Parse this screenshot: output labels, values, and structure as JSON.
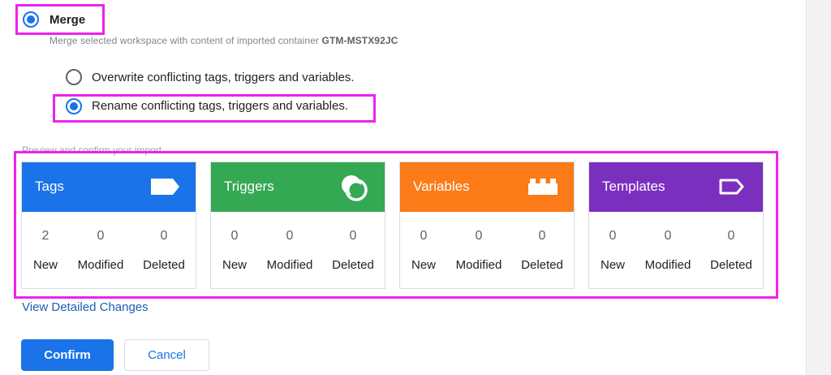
{
  "import_mode": {
    "merge_label": "Merge",
    "merge_description": "Merge selected workspace with content of imported container",
    "container_id": "GTM-MSTX92JC",
    "options": [
      {
        "label": "Overwrite conflicting tags, triggers and variables.",
        "selected": false
      },
      {
        "label": "Rename conflicting tags, triggers and variables.",
        "selected": true
      }
    ]
  },
  "preview": {
    "label": "Preview and confirm your import",
    "cards": [
      {
        "title": "Tags",
        "icon": "tag-icon",
        "color": "#1a73e8",
        "new": "2",
        "modified": "0",
        "deleted": "0"
      },
      {
        "title": "Triggers",
        "icon": "trigger-icon",
        "color": "#34a853",
        "new": "0",
        "modified": "0",
        "deleted": "0"
      },
      {
        "title": "Variables",
        "icon": "variable-icon",
        "color": "#fa7b17",
        "new": "0",
        "modified": "0",
        "deleted": "0"
      },
      {
        "title": "Templates",
        "icon": "template-icon",
        "color": "#7b2fbf",
        "new": "0",
        "modified": "0",
        "deleted": "0"
      }
    ],
    "stat_labels": {
      "new": "New",
      "modified": "Modified",
      "deleted": "Deleted"
    }
  },
  "view_changes_link": "View Detailed Changes",
  "buttons": {
    "confirm": "Confirm",
    "cancel": "Cancel"
  },
  "highlight_color": "#ee22ee"
}
